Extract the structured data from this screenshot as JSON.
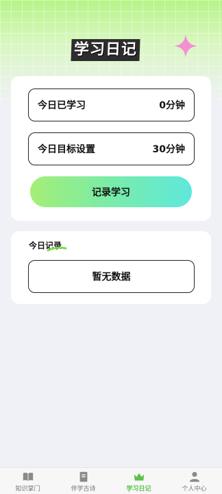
{
  "header": {
    "title": "学习日记",
    "sparkle_color": "#f48fd0"
  },
  "stats": {
    "today_label": "今日已学习",
    "today_value": "0分钟",
    "goal_label": "今日目标设置",
    "goal_value": "30分钟"
  },
  "actions": {
    "record_label": "记录学习"
  },
  "records": {
    "title": "今日记录",
    "empty_text": "暂无数据"
  },
  "tabbar": {
    "active_color": "#5cc24d",
    "items": [
      {
        "label": "知识掌门",
        "icon": "book-icon"
      },
      {
        "label": "伴学古诗",
        "icon": "scroll-icon"
      },
      {
        "label": "学习日记",
        "icon": "crown-icon"
      },
      {
        "label": "个人中心",
        "icon": "person-icon"
      }
    ],
    "active_index": 2
  }
}
